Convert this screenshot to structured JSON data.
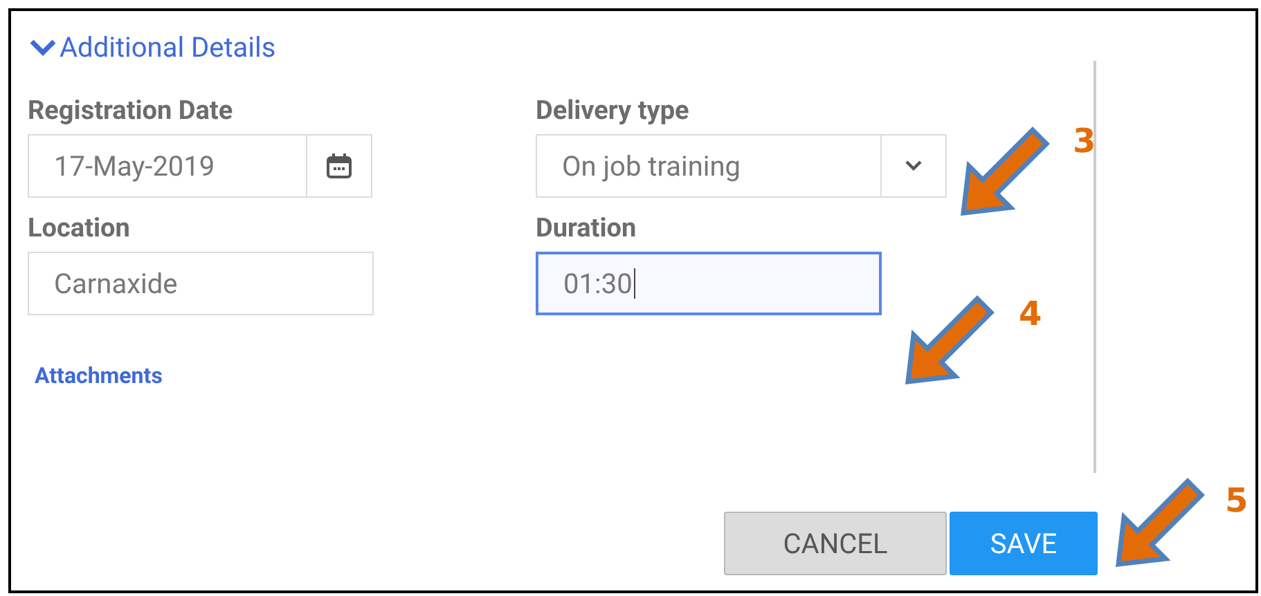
{
  "section": {
    "title": "Additional Details",
    "expanded": true
  },
  "fields": [
    {
      "kind": "date",
      "label": "Registration Date",
      "value": "17-May-2019",
      "focused": false
    },
    {
      "kind": "select",
      "label": "Delivery type",
      "value": "On job training",
      "focused": false
    },
    {
      "kind": "text",
      "label": "Location",
      "value": "Carnaxide",
      "focused": false
    },
    {
      "kind": "text",
      "label": "Duration",
      "value": "01:30",
      "focused": true
    }
  ],
  "attachments_link": "Attachments",
  "buttons": [
    {
      "label": "CANCEL",
      "kind": "secondary"
    },
    {
      "label": "SAVE",
      "kind": "primary"
    }
  ],
  "annotations": [
    {
      "label": "3"
    },
    {
      "label": "4"
    },
    {
      "label": "5"
    }
  ]
}
